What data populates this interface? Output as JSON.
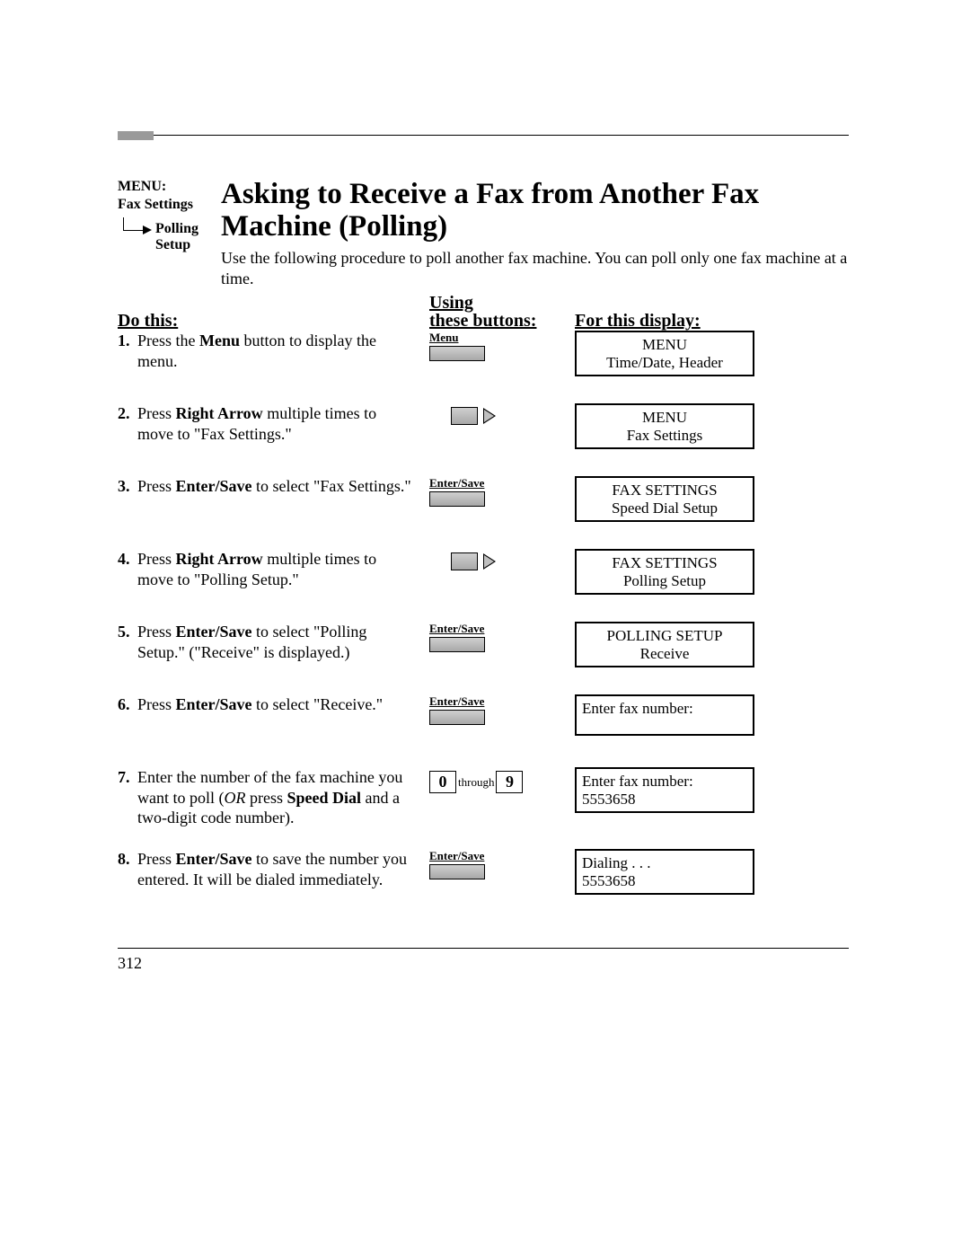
{
  "menu_path": {
    "label": "MENU:",
    "item1": "Fax Settings",
    "item2_line1": "Polling",
    "item2_line2": "Setup"
  },
  "title": "Asking to Receive a Fax from Another Fax Machine (Polling)",
  "intro": "Use the following procedure to poll another fax machine. You can poll only one fax machine at a time.",
  "headers": {
    "do_this": "Do this:",
    "using_line1": "Using",
    "using_line2": "these buttons:",
    "for_display": "For this display:"
  },
  "button_labels": {
    "menu": "Menu",
    "enter_save": "Enter/Save",
    "through": "through",
    "zero": "0",
    "nine": "9"
  },
  "steps": [
    {
      "num": "1.",
      "prefix": "Press the ",
      "bold1": "Menu",
      "suffix": " button to display the menu."
    },
    {
      "num": "2.",
      "prefix": "Press ",
      "bold1": "Right Arrow",
      "suffix": " multiple times to move to \"Fax Settings.\""
    },
    {
      "num": "3.",
      "prefix": "Press ",
      "bold1": "Enter/Save",
      "suffix": " to select \"Fax Settings.\""
    },
    {
      "num": "4.",
      "prefix": "Press ",
      "bold1": "Right Arrow",
      "suffix": " multiple times to move to \"Polling Setup.\""
    },
    {
      "num": "5.",
      "prefix": "Press ",
      "bold1": "Enter/Save",
      "suffix": " to select \"Polling Setup.\" (\"Receive\" is displayed.)"
    },
    {
      "num": "6.",
      "prefix": "Press ",
      "bold1": "Enter/Save",
      "suffix": " to select \"Receive.\""
    },
    {
      "num": "7.",
      "prefix": "Enter the number of the fax machine you want to poll (",
      "italic1": "OR",
      "mid": " press ",
      "bold1": "Speed Dial",
      "suffix": " and a two-digit code number)."
    },
    {
      "num": "8.",
      "prefix": "Press ",
      "bold1": "Enter/Save",
      "suffix": " to save the number you entered. It will be dialed immediately."
    }
  ],
  "displays": [
    {
      "line1": "MENU",
      "line2": "Time/Date, Header",
      "align": "center"
    },
    {
      "line1": "MENU",
      "line2": "Fax Settings",
      "align": "center"
    },
    {
      "line1": "FAX  SETTINGS",
      "line2": "Speed Dial Setup",
      "align": "center"
    },
    {
      "line1": "FAX  SETTINGS",
      "line2": "Polling Setup",
      "align": "center"
    },
    {
      "line1": "POLLING  SETUP",
      "line2": "Receive",
      "align": "center"
    },
    {
      "line1": "Enter fax number:",
      "line2": "",
      "align": "left"
    },
    {
      "line1": "Enter fax number:",
      "line2": "5553658",
      "align": "left"
    },
    {
      "line1": "Dialing . . .",
      "line2": "5553658",
      "align": "left"
    }
  ],
  "page_number": "312"
}
